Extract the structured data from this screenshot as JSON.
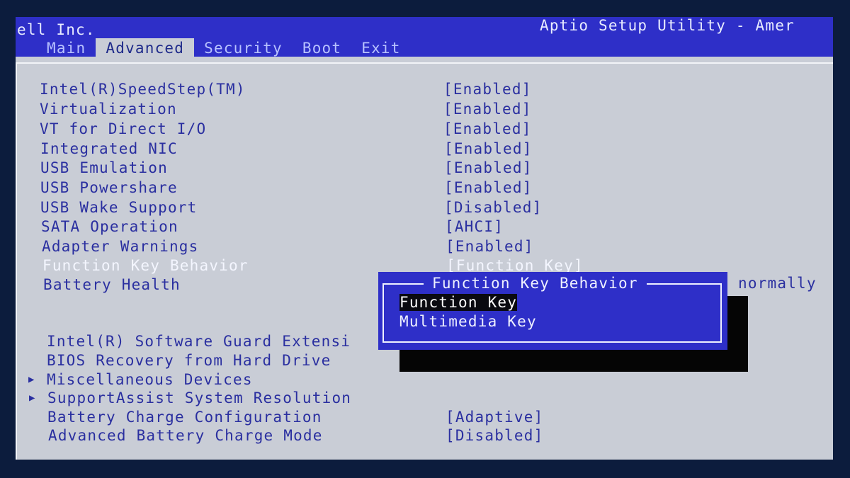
{
  "header": {
    "vendor": "ell Inc.",
    "utility": "Aptio Setup Utility - Amer"
  },
  "tabs": [
    {
      "label": "Main",
      "active": false
    },
    {
      "label": "Advanced",
      "active": true
    },
    {
      "label": "Security",
      "active": false
    },
    {
      "label": "Boot",
      "active": false
    },
    {
      "label": "Exit",
      "active": false
    }
  ],
  "settings": [
    {
      "label": "Intel(R)SpeedStep(TM)",
      "value": "[Enabled]"
    },
    {
      "label": "Virtualization",
      "value": "[Enabled]"
    },
    {
      "label": "VT for Direct I/O",
      "value": "[Enabled]"
    },
    {
      "label": "Integrated NIC",
      "value": "[Enabled]"
    },
    {
      "label": "USB Emulation",
      "value": "[Enabled]"
    },
    {
      "label": "USB Powershare",
      "value": "[Enabled]"
    },
    {
      "label": "USB Wake Support",
      "value": "[Disabled]"
    },
    {
      "label": "SATA Operation",
      "value": "[AHCI]"
    },
    {
      "label": "Adapter Warnings",
      "value": "[Enabled]"
    },
    {
      "label": "Function Key Behavior",
      "value": "[Function Key]",
      "selected": true
    },
    {
      "label": "Battery Health",
      "value": ""
    },
    {
      "label": "Intel(R) Software Guard Extensi",
      "value": ""
    },
    {
      "label": "BIOS Recovery from Hard Drive",
      "value": ""
    },
    {
      "label": "Miscellaneous Devices",
      "value": "",
      "submenu": true
    },
    {
      "label": "SupportAssist System Resolution",
      "value": "",
      "submenu": true
    },
    {
      "label": "Battery Charge Configuration",
      "value": "[Adaptive]"
    },
    {
      "label": "Advanced Battery Charge Mode",
      "value": "[Disabled]"
    }
  ],
  "side_note": "normally",
  "popup": {
    "title": "Function Key Behavior",
    "options": [
      {
        "label": "Function Key",
        "active": true
      },
      {
        "label": "Multimedia Key",
        "active": false
      }
    ]
  },
  "icons": {
    "submenu_arrow": "▶"
  },
  "colors": {
    "bios_blue": "#2e2fc8",
    "panel_gray": "#c9cdd6",
    "text_blue": "#2a2fa0",
    "highlight_white": "#f4f6ff"
  }
}
